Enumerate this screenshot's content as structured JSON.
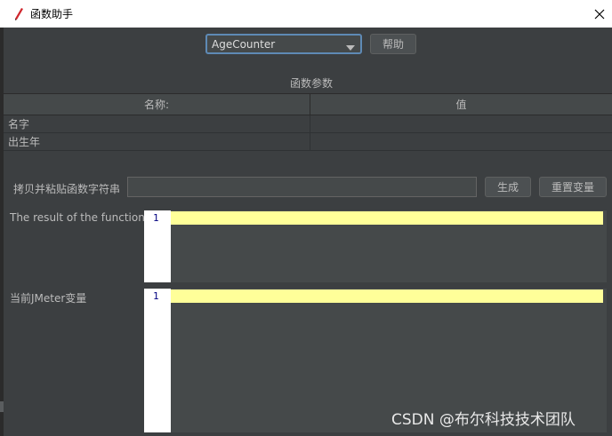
{
  "window": {
    "title": "函数助手"
  },
  "toolbar": {
    "function_selected": "AgeCounter",
    "help_label": "帮助"
  },
  "params": {
    "section_title": "函数参数",
    "headers": {
      "name": "名称:",
      "value": "值"
    },
    "rows": [
      {
        "name": "名字",
        "value": ""
      },
      {
        "name": "出生年",
        "value": ""
      }
    ]
  },
  "copy": {
    "label": "拷贝并粘贴函数字符串",
    "value": "",
    "generate_label": "生成",
    "reset_label": "重置变量"
  },
  "result": {
    "label": "The result of the function is",
    "line_number": "1"
  },
  "vars": {
    "label": "当前JMeter变量",
    "line_number": "1"
  },
  "watermark": "CSDN @布尔科技技术团队",
  "colors": {
    "accent": "#5e8ab5",
    "highlight": "#ffff99",
    "background": "#3c3f41"
  }
}
